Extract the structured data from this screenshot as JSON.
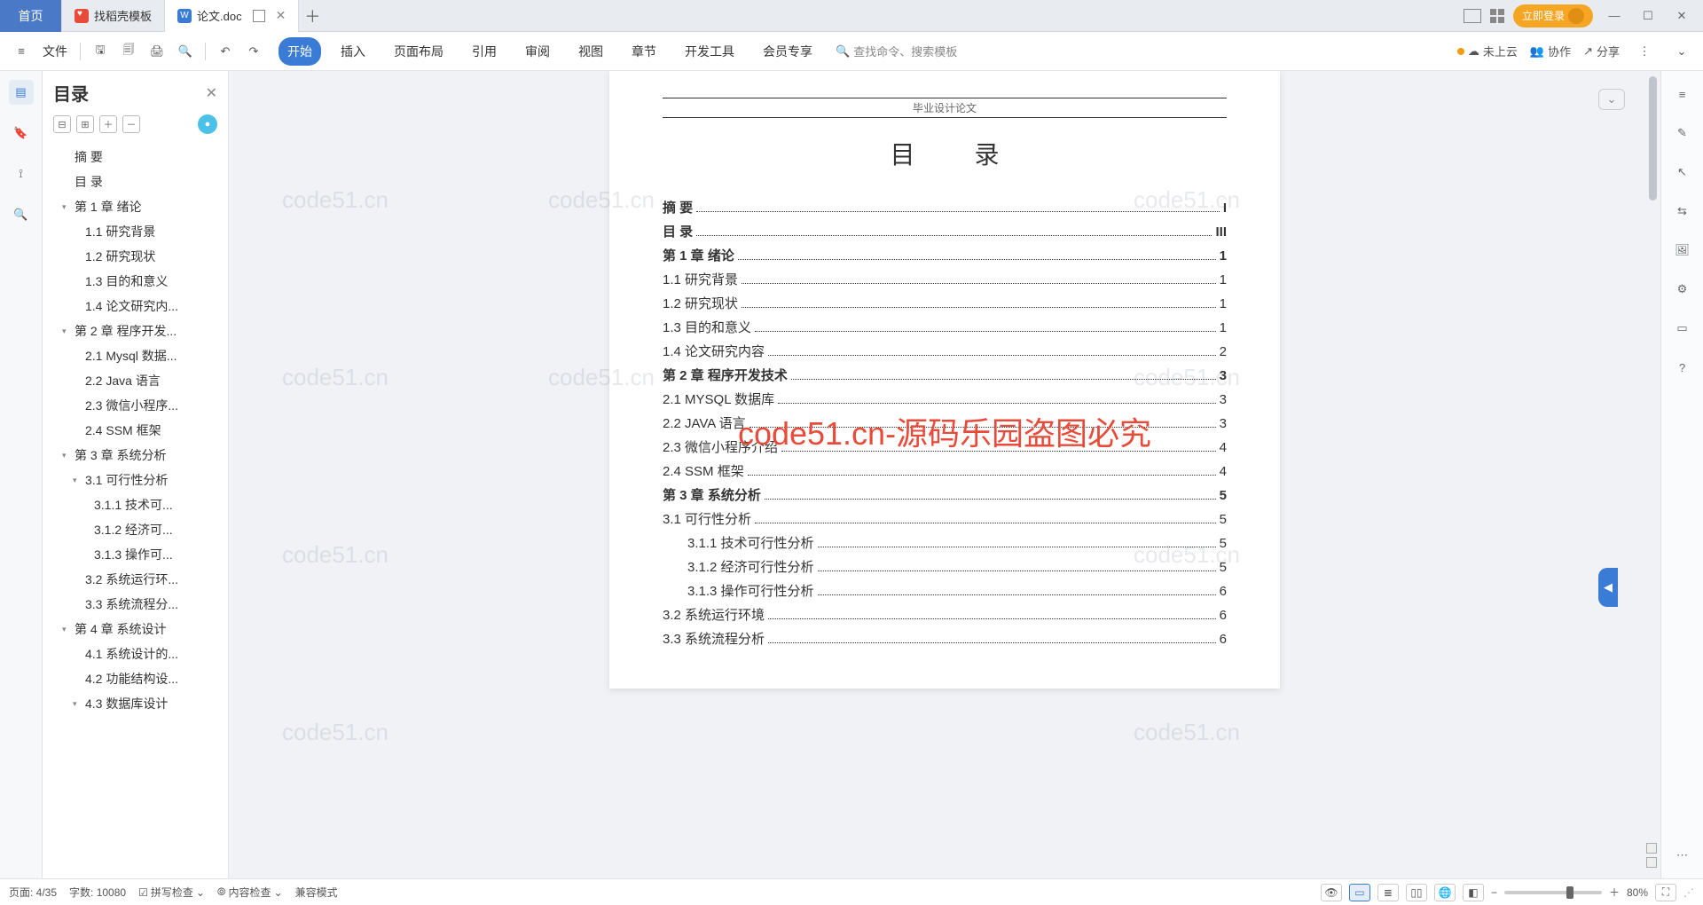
{
  "tabs": {
    "home": "首页",
    "template": "找稻壳模板",
    "doc": "论文.doc"
  },
  "login_label": "立即登录",
  "file_label": "文件",
  "menu": [
    "开始",
    "插入",
    "页面布局",
    "引用",
    "审阅",
    "视图",
    "章节",
    "开发工具",
    "会员专享"
  ],
  "search_placeholder": "查找命令、搜索模板",
  "ribbon_right": {
    "cloud": "未上云",
    "coop": "协作",
    "share": "分享"
  },
  "outline": {
    "title": "目录",
    "items": [
      {
        "t": "摘  要",
        "lvl": 1
      },
      {
        "t": "目  录",
        "lvl": 1
      },
      {
        "t": "第 1 章  绪论",
        "lvl": 1,
        "c": true
      },
      {
        "t": "1.1 研究背景",
        "lvl": 2
      },
      {
        "t": "1.2 研究现状",
        "lvl": 2
      },
      {
        "t": "1.3 目的和意义",
        "lvl": 2
      },
      {
        "t": "1.4 论文研究内...",
        "lvl": 2
      },
      {
        "t": "第 2 章  程序开发...",
        "lvl": 1,
        "c": true
      },
      {
        "t": "2.1 Mysql 数据...",
        "lvl": 2
      },
      {
        "t": "2.2 Java 语言",
        "lvl": 2
      },
      {
        "t": "2.3 微信小程序...",
        "lvl": 2
      },
      {
        "t": "2.4 SSM 框架",
        "lvl": 2
      },
      {
        "t": "第 3 章  系统分析",
        "lvl": 1,
        "c": true
      },
      {
        "t": "3.1 可行性分析",
        "lvl": 2,
        "c": true
      },
      {
        "t": "3.1.1 技术可...",
        "lvl": 3
      },
      {
        "t": "3.1.2 经济可...",
        "lvl": 3
      },
      {
        "t": "3.1.3 操作可...",
        "lvl": 3
      },
      {
        "t": "3.2 系统运行环...",
        "lvl": 2
      },
      {
        "t": "3.3 系统流程分...",
        "lvl": 2
      },
      {
        "t": "第 4 章  系统设计",
        "lvl": 1,
        "c": true
      },
      {
        "t": "4.1 系统设计的...",
        "lvl": 2
      },
      {
        "t": "4.2 功能结构设...",
        "lvl": 2
      },
      {
        "t": "4.3 数据库设计",
        "lvl": 2,
        "c": true
      }
    ]
  },
  "page_header": "毕业设计论文",
  "doc_title": "目 录",
  "toc": [
    {
      "label": "摘  要",
      "pg": "I",
      "bold": true,
      "ind": 1
    },
    {
      "label": "目  录",
      "pg": "III",
      "bold": true,
      "ind": 1
    },
    {
      "label": "第 1 章  绪论",
      "pg": "1",
      "bold": true,
      "ind": 1
    },
    {
      "label": "1.1 研究背景",
      "pg": "1",
      "ind": 2
    },
    {
      "label": "1.2 研究现状",
      "pg": "1",
      "ind": 2
    },
    {
      "label": "1.3 目的和意义",
      "pg": "1",
      "ind": 2
    },
    {
      "label": "1.4 论文研究内容",
      "pg": "2",
      "ind": 2
    },
    {
      "label": "第 2 章  程序开发技术",
      "pg": "3",
      "bold": true,
      "ind": 1
    },
    {
      "label": "2.1 MYSQL 数据库",
      "pg": "3",
      "ind": 2
    },
    {
      "label": "2.2 JAVA 语言",
      "pg": "3",
      "ind": 2
    },
    {
      "label": "2.3 微信小程序介绍",
      "pg": "4",
      "ind": 2
    },
    {
      "label": "2.4 SSM 框架",
      "pg": "4",
      "ind": 2
    },
    {
      "label": "第 3 章  系统分析",
      "pg": "5",
      "bold": true,
      "ind": 1
    },
    {
      "label": "3.1 可行性分析",
      "pg": "5",
      "ind": 2
    },
    {
      "label": "3.1.1 技术可行性分析",
      "pg": "5",
      "ind": 3
    },
    {
      "label": "3.1.2 经济可行性分析",
      "pg": "5",
      "ind": 3
    },
    {
      "label": "3.1.3 操作可行性分析",
      "pg": "6",
      "ind": 3
    },
    {
      "label": "3.2 系统运行环境",
      "pg": "6",
      "ind": 2
    },
    {
      "label": "3.3 系统流程分析",
      "pg": "6",
      "ind": 2
    }
  ],
  "overlay_red": "code51.cn-源码乐园盗图必究",
  "overlay_gray": "code51.cn",
  "status": {
    "page": "页面: 4/35",
    "words": "字数: 10080",
    "spell": "拼写检查",
    "content": "内容检查",
    "compat": "兼容模式",
    "zoom": "80%"
  }
}
